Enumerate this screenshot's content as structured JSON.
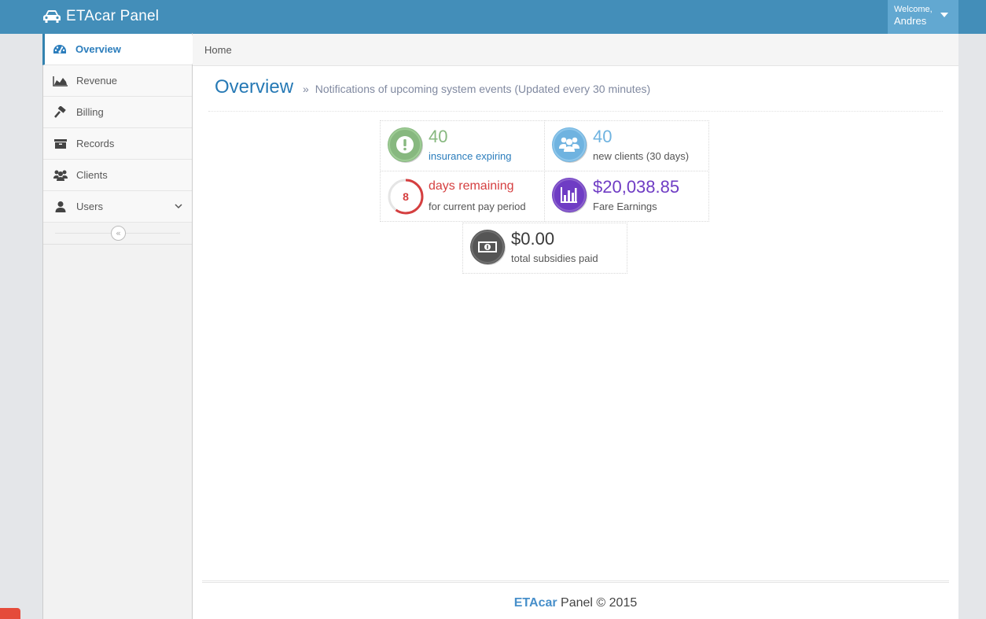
{
  "navbar": {
    "brand": "ETAcar Panel",
    "welcome_line1": "Welcome,",
    "welcome_line2": "Andres"
  },
  "sidebar": {
    "items": [
      {
        "label": "Overview",
        "icon": "dashboard-icon",
        "active": true
      },
      {
        "label": "Revenue",
        "icon": "area-chart-icon"
      },
      {
        "label": "Billing",
        "icon": "gavel-icon"
      },
      {
        "label": "Records",
        "icon": "archive-icon"
      },
      {
        "label": "Clients",
        "icon": "users-icon"
      },
      {
        "label": "Users",
        "icon": "user-icon"
      }
    ],
    "collapse_symbol": "«"
  },
  "breadcrumb": {
    "home": "Home"
  },
  "page_header": {
    "title": "Overview",
    "separator": "»",
    "subtitle": "Notifications of upcoming system events (Updated every 30 minutes)"
  },
  "infoboxes": {
    "insurance": {
      "value": "40",
      "caption": "insurance expiring",
      "color": "#87b87f"
    },
    "clients": {
      "value": "40",
      "caption": "new clients (30 days)",
      "color": "#6fb3e0"
    },
    "days": {
      "ring_value": "8",
      "ring_progress": 0.6,
      "title": "days remaining",
      "caption": "for current pay period",
      "color": "#d53f40"
    },
    "earnings": {
      "value": "$20,038.85",
      "caption": "Fare Earnings",
      "color": "#6f3cc4"
    },
    "subsidies": {
      "value": "$0.00",
      "caption": "total subsidies paid",
      "color": "#555555"
    }
  },
  "footer": {
    "brand": "ETAcar",
    "rest": " Panel © 2015"
  }
}
